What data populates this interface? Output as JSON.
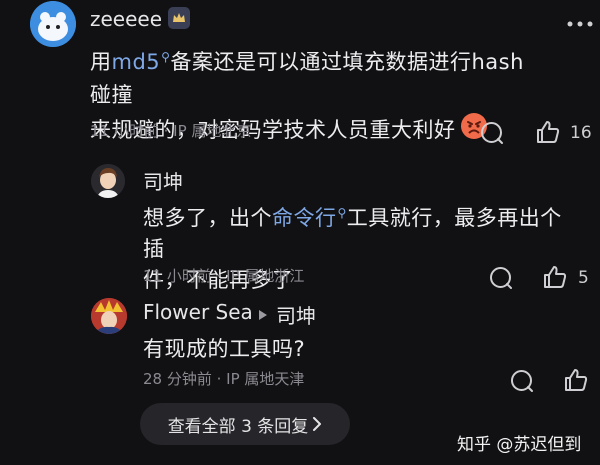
{
  "comments": [
    {
      "author": "zeeeee",
      "text_parts": [
        "用",
        "md5",
        "备案还是可以通过填充数据进行hash碰撞",
        "来规避的，对密码学技术人员重大利好"
      ],
      "meta": "11 小时前 · IP 属地北京",
      "likes": "16"
    },
    {
      "author": "司坤",
      "text_parts": [
        "想多了，出个",
        "命令行",
        "工具就行，最多再出个插",
        "件，不能再多了"
      ],
      "meta": "11 小时前 · IP 属地浙江",
      "likes": "5"
    },
    {
      "author": "Flower Sea",
      "reply_to": "司坤",
      "text": "有现成的工具吗?",
      "meta": "28 分钟前 · IP 属地天津"
    }
  ],
  "view_more": "查看全部 3 条回复",
  "watermark": "知乎 @苏迟但到",
  "colors": {
    "background": "#111113",
    "link": "#7fa8e6",
    "meta": "#8a8a90"
  }
}
